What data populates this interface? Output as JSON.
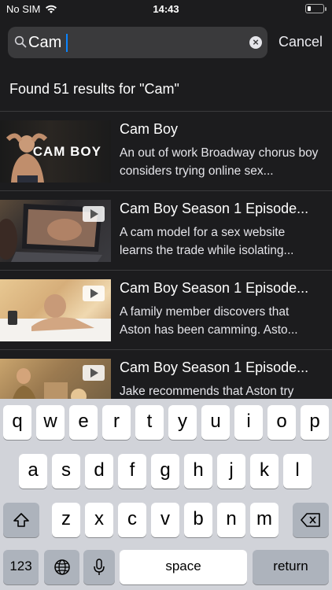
{
  "status_bar": {
    "carrier": "No SIM",
    "time": "14:43"
  },
  "search": {
    "value": "Cam",
    "cancel_label": "Cancel"
  },
  "results_header": "Found 51 results for \"Cam\"",
  "results": [
    {
      "title": "Cam Boy",
      "description": "An out of work Broadway chorus boy considers trying online sex...",
      "thumb_caption": "CAM BOY"
    },
    {
      "title": "Cam Boy Season 1 Episode...",
      "description": "A cam model for a sex website learns the trade while isolating..."
    },
    {
      "title": "Cam Boy Season 1 Episode...",
      "description": "A family member discovers that Aston has been camming. Asto..."
    },
    {
      "title": "Cam Boy Season 1 Episode...",
      "description": "Jake recommends that Aston try"
    }
  ],
  "keyboard": {
    "row1": [
      "q",
      "w",
      "e",
      "r",
      "t",
      "y",
      "u",
      "i",
      "o",
      "p"
    ],
    "row2": [
      "a",
      "s",
      "d",
      "f",
      "g",
      "h",
      "j",
      "k",
      "l"
    ],
    "row3": [
      "z",
      "x",
      "c",
      "v",
      "b",
      "n",
      "m"
    ],
    "numbers_label": "123",
    "space_label": "space",
    "return_label": "return"
  }
}
